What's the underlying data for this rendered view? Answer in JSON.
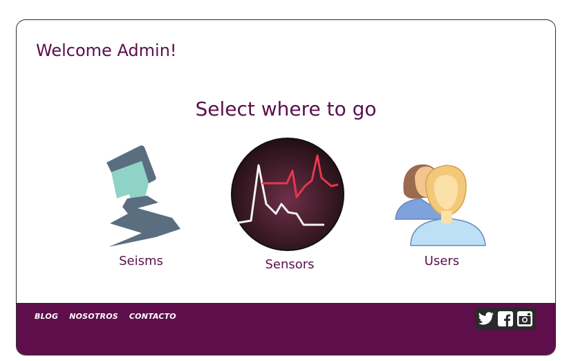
{
  "header": {
    "welcome": "Welcome Admin!"
  },
  "main": {
    "title": "Select where to go",
    "options": [
      {
        "label": "Seisms",
        "icon": "house-earthquake-icon"
      },
      {
        "label": "Sensors",
        "icon": "seismograph-icon"
      },
      {
        "label": "Users",
        "icon": "users-icon"
      }
    ]
  },
  "footer": {
    "links": [
      "BLOG",
      "NOSOTROS",
      "CONTACTO"
    ],
    "social": [
      "twitter-icon",
      "facebook-icon",
      "instagram-icon"
    ]
  },
  "colors": {
    "primary": "#5e0f4b",
    "text": "#5a0f4c",
    "social_bg": "#2a2a2a"
  }
}
